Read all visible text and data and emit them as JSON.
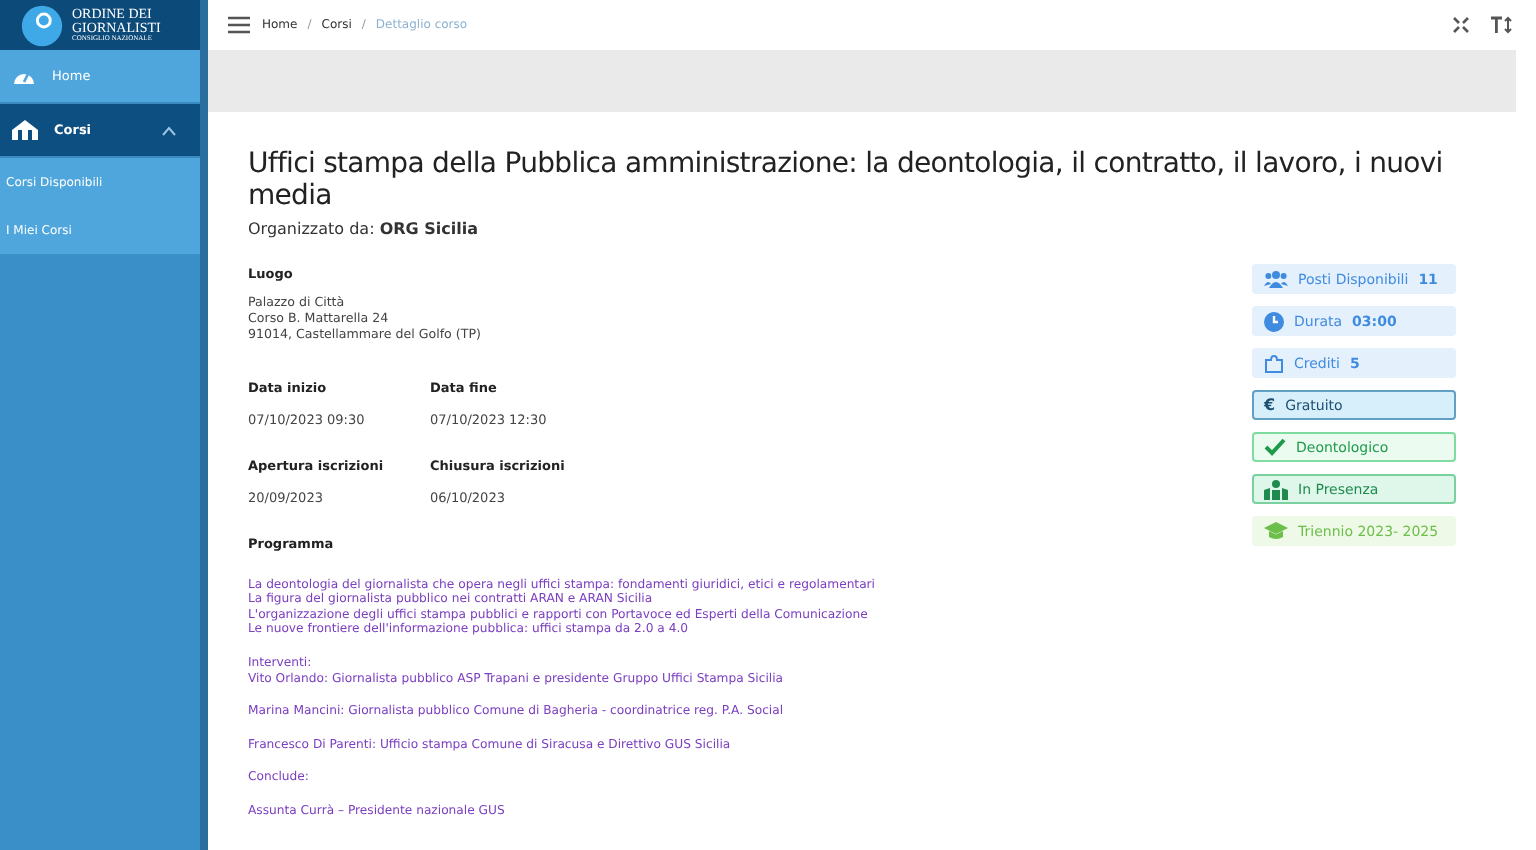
{
  "logo": {
    "line1": "ORDINE DEI",
    "line2": "GIORNALISTI",
    "line3": "CONSIGLIO NAZIONALE"
  },
  "sidebar": {
    "items": [
      {
        "label": "Home",
        "selected": false
      },
      {
        "label": "Corsi",
        "selected": true,
        "expanded": true,
        "children": [
          {
            "label": "Corsi Disponibili"
          },
          {
            "label": "I Miei Corsi"
          }
        ]
      }
    ]
  },
  "breadcrumb_separator": "/",
  "breadcrumb": [
    {
      "label": "Home",
      "current": false
    },
    {
      "label": "Corsi",
      "current": false
    },
    {
      "label": "Dettaglio corso",
      "current": true
    }
  ],
  "course": {
    "title": "Uffici stampa della Pubblica amministrazione: la deontologia, il contratto, il lavoro, i nuovi media",
    "organizer_label": "Organizzato da:",
    "organizer": "ORG Sicilia",
    "luogo": {
      "label": "Luogo",
      "lines": [
        "Palazzo di Città",
        "Corso B. Mattarella 24",
        "91014, Castellammare del Golfo (TP)"
      ]
    },
    "fields": [
      {
        "label": "Data inizio",
        "value": "07/10/2023 09:30"
      },
      {
        "label": "Data fine",
        "value": "07/10/2023 12:30"
      },
      {
        "label": "Apertura iscrizioni",
        "value": "20/09/2023"
      },
      {
        "label": "Chiusura iscrizioni",
        "value": "06/10/2023"
      }
    ],
    "programma": {
      "label": "Programma",
      "paragraphs": [
        [
          "La deontologia del giornalista che opera negli uffici stampa: fondamenti giuridici, etici e regolamentari",
          "La figura del giornalista pubblico nei contratti ARAN e ARAN Sicilia",
          "L'organizzazione degli uffici stampa pubblici e rapporti con Portavoce ed Esperti della Comunicazione",
          "Le nuove frontiere dell'informazione pubblica: uffici stampa da 2.0 a 4.0"
        ],
        [
          "Interventi:",
          "Vito Orlando: Giornalista pubblico ASP Trapani e presidente Gruppo Uffici Stampa Sicilia"
        ],
        [
          "Marina Mancini: Giornalista pubblico Comune di Bagheria - coordinatrice reg. P.A. Social"
        ],
        [
          "Francesco Di Parenti: Ufficio stampa Comune di Siracusa e Direttivo GUS Sicilia"
        ],
        [
          "Conclude:"
        ],
        [
          "Assunta Currà – Presidente nazionale GUS"
        ]
      ]
    }
  },
  "badges": [
    {
      "kind": "info",
      "label": "Posti Disponibili",
      "value": "11"
    },
    {
      "kind": "info",
      "label": "Durata",
      "value": "03:00"
    },
    {
      "kind": "info",
      "label": "Crediti",
      "value": "5"
    },
    {
      "kind": "price",
      "symbol": "€",
      "label": "Gratuito"
    },
    {
      "kind": "success",
      "label": "Deontologico"
    },
    {
      "kind": "presence",
      "label": "In Presenza"
    },
    {
      "kind": "period",
      "label": "Triennio 2023- 2025"
    }
  ]
}
